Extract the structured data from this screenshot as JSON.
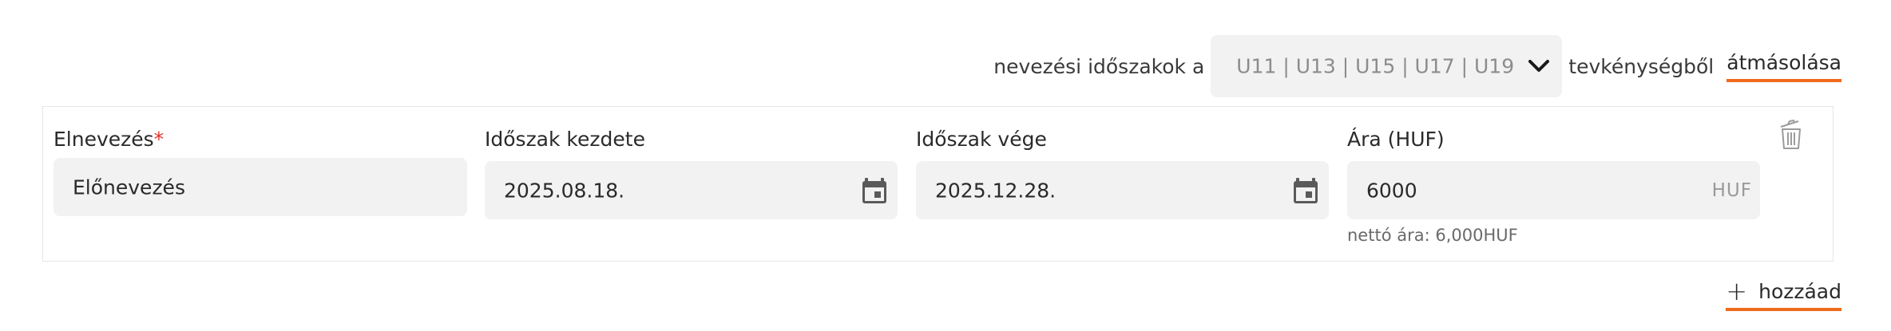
{
  "copy_row": {
    "prefix": "nevezési időszakok a",
    "selected_activity": "U11 | U13 | U15 | U17 | U19",
    "suffix": "tevkénységből",
    "link_label": "átmásolása"
  },
  "period": {
    "name": {
      "label": "Elnevezés",
      "required_mark": "*",
      "value": "Előnevezés"
    },
    "start": {
      "label": "Időszak kezdete",
      "value": "2025.08.18."
    },
    "end": {
      "label": "Időszak vége",
      "value": "2025.12.28."
    },
    "price": {
      "label": "Ára (HUF)",
      "value": "6000",
      "currency_suffix": "HUF",
      "net_note": "nettó ára: 6,000HUF"
    }
  },
  "add": {
    "icon": "+",
    "label": "hozzáad"
  },
  "colors": {
    "accent": "#f06a1c",
    "required": "#e0302a",
    "input_bg": "#f2f2f2"
  },
  "icons": [
    "chevron-down-icon",
    "calendar-icon",
    "trash-icon",
    "plus-icon"
  ]
}
